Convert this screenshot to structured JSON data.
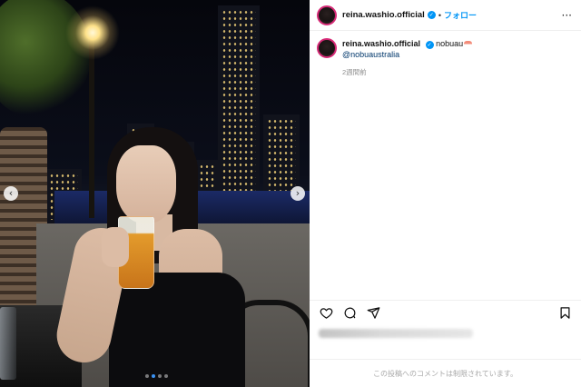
{
  "post": {
    "username": "reina.washio.official",
    "verified_mark": "✓",
    "separator": "•",
    "follow_label": "フォロー",
    "more_icon": "more-horizontal-icon"
  },
  "caption": {
    "username": "reina.washio.official",
    "text": "nobuau",
    "emoji_icon": "sushi-icon",
    "mention": "@nobuaustralia",
    "time": "2週間前"
  },
  "media": {
    "prev_icon": "‹",
    "next_icon": "›",
    "slide_count": 4,
    "active_slide": 2
  },
  "actions": {
    "like_icon": "heart-icon",
    "comment_icon": "comment-icon",
    "share_icon": "share-icon",
    "save_icon": "bookmark-icon"
  },
  "footer": {
    "comments_restricted": "この投稿へのコメントは制限されています。"
  },
  "colors": {
    "accent": "#0095f6",
    "mention": "#00376b",
    "muted": "#8e8e8e"
  }
}
